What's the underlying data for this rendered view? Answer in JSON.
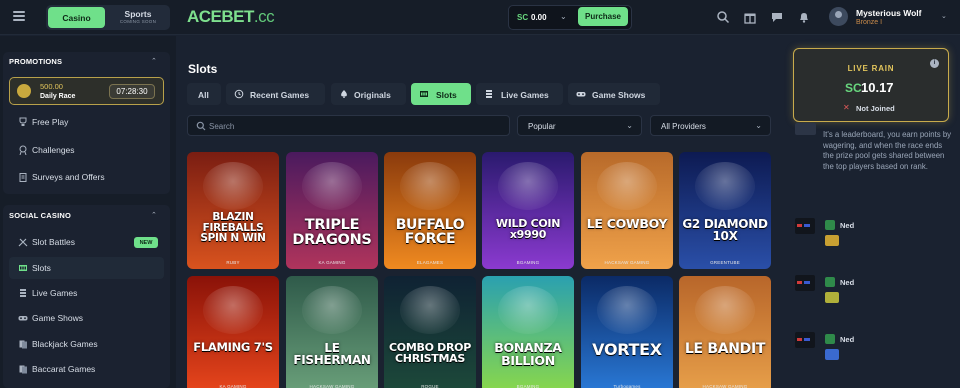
{
  "header": {
    "mode_casino": "Casino",
    "mode_sports": "Sports",
    "mode_sports_sub": "COMING SOON",
    "logo_main": "ACEBET",
    "logo_tld": ".cc",
    "balance_currency": "SC",
    "balance_amount": "0.00",
    "purchase_label": "Purchase",
    "user_name": "Mysterious Wolf",
    "user_rank": "Bronze I",
    "icons": [
      "search-icon",
      "gift-icon",
      "chat-icon",
      "bell-icon"
    ]
  },
  "sidebar": {
    "promotions_title": "PROMOTIONS",
    "race_amount": "500.00",
    "race_label": "Daily Race",
    "race_timer": "07:28:30",
    "promo_items": [
      {
        "label": "Free Play",
        "icon": "trophy-icon"
      },
      {
        "label": "Challenges",
        "icon": "medal-icon"
      },
      {
        "label": "Surveys and Offers",
        "icon": "clipboard-icon"
      }
    ],
    "social_title": "SOCIAL CASINO",
    "social_items": [
      {
        "label": "Slot Battles",
        "icon": "sword-icon",
        "badge": "NEW"
      },
      {
        "label": "Slots",
        "icon": "slot-icon"
      },
      {
        "label": "Live Games",
        "icon": "chip-icon"
      },
      {
        "label": "Game Shows",
        "icon": "gamepad-icon"
      },
      {
        "label": "Blackjack Games",
        "icon": "cards-icon"
      },
      {
        "label": "Baccarat Games",
        "icon": "cards-icon"
      }
    ]
  },
  "main": {
    "title": "Slots",
    "tabs": [
      {
        "label": "All"
      },
      {
        "label": "Recent Games",
        "icon": "history-icon"
      },
      {
        "label": "Originals",
        "icon": "spade-icon"
      },
      {
        "label": "Slots",
        "icon": "slot-icon",
        "active": true
      },
      {
        "label": "Live Games",
        "icon": "chip-icon"
      },
      {
        "label": "Game Shows",
        "icon": "gamepad-icon"
      }
    ],
    "search_placeholder": "Search",
    "sort_value": "Popular",
    "provider_value": "All Providers",
    "games": [
      {
        "title": "BLAZIN FIREBALLS SPIN N WIN",
        "studio": "RUBY",
        "bg1": "#7a1d12",
        "bg2": "#d9531e"
      },
      {
        "title": "TRIPLE DRAGONS",
        "studio": "KA GAMING",
        "bg1": "#4a1a5e",
        "bg2": "#b0345c"
      },
      {
        "title": "BUFFALO FORCE",
        "studio": "ELAGAMES",
        "bg1": "#8a3a0c",
        "bg2": "#f08a20"
      },
      {
        "title": "WILD COIN x9990",
        "studio": "BGAMING",
        "bg1": "#2a1a6e",
        "bg2": "#8b3ad0"
      },
      {
        "title": "LE COWBOY",
        "studio": "HACKSAW GAMING",
        "bg1": "#b86a2a",
        "bg2": "#f0a24a"
      },
      {
        "title": "G2 DIAMOND 10X",
        "studio": "GREENTUBE",
        "bg1": "#0d1a52",
        "bg2": "#2a4fa8"
      },
      {
        "title": "FLAMING 7'S",
        "studio": "KA GAMING",
        "bg1": "#8a1208",
        "bg2": "#e8461c"
      },
      {
        "title": "LE FISHERMAN",
        "studio": "HACKSAW GAMING",
        "bg1": "#2f5a4a",
        "bg2": "#6aa07a"
      },
      {
        "title": "COMBO DROP CHRISTMAS",
        "studio": "ROGUE",
        "bg1": "#0f2233",
        "bg2": "#1d4a3a"
      },
      {
        "title": "BONANZA BILLION",
        "studio": "BGAMING",
        "bg1": "#2aa0b0",
        "bg2": "#8ad84a"
      },
      {
        "title": "VORTEX",
        "studio": "Turbogames",
        "bg1": "#0b2a66",
        "bg2": "#2a7ad8"
      },
      {
        "title": "LE BANDIT",
        "studio": "HACKSAW GAMING",
        "bg1": "#b8662a",
        "bg2": "#e8a04a"
      }
    ]
  },
  "rain": {
    "title": "LIVE RAIN",
    "currency": "SC",
    "amount": "10.17",
    "status": "Not Joined",
    "description": "It's a leaderboard, you earn points by wagering, and when the race ends the prize pool gets shared between the top players based on rank."
  },
  "chat": [
    {
      "name": "Ned",
      "gif_color": "#c8a032"
    },
    {
      "name": "Ned",
      "gif_color": "#b0b03a"
    },
    {
      "name": "Ned",
      "gif_color": "#3a6ad0"
    }
  ],
  "colors": {
    "accent": "#6fe08a",
    "gold": "#e2c55c",
    "background": "#1a2230"
  }
}
